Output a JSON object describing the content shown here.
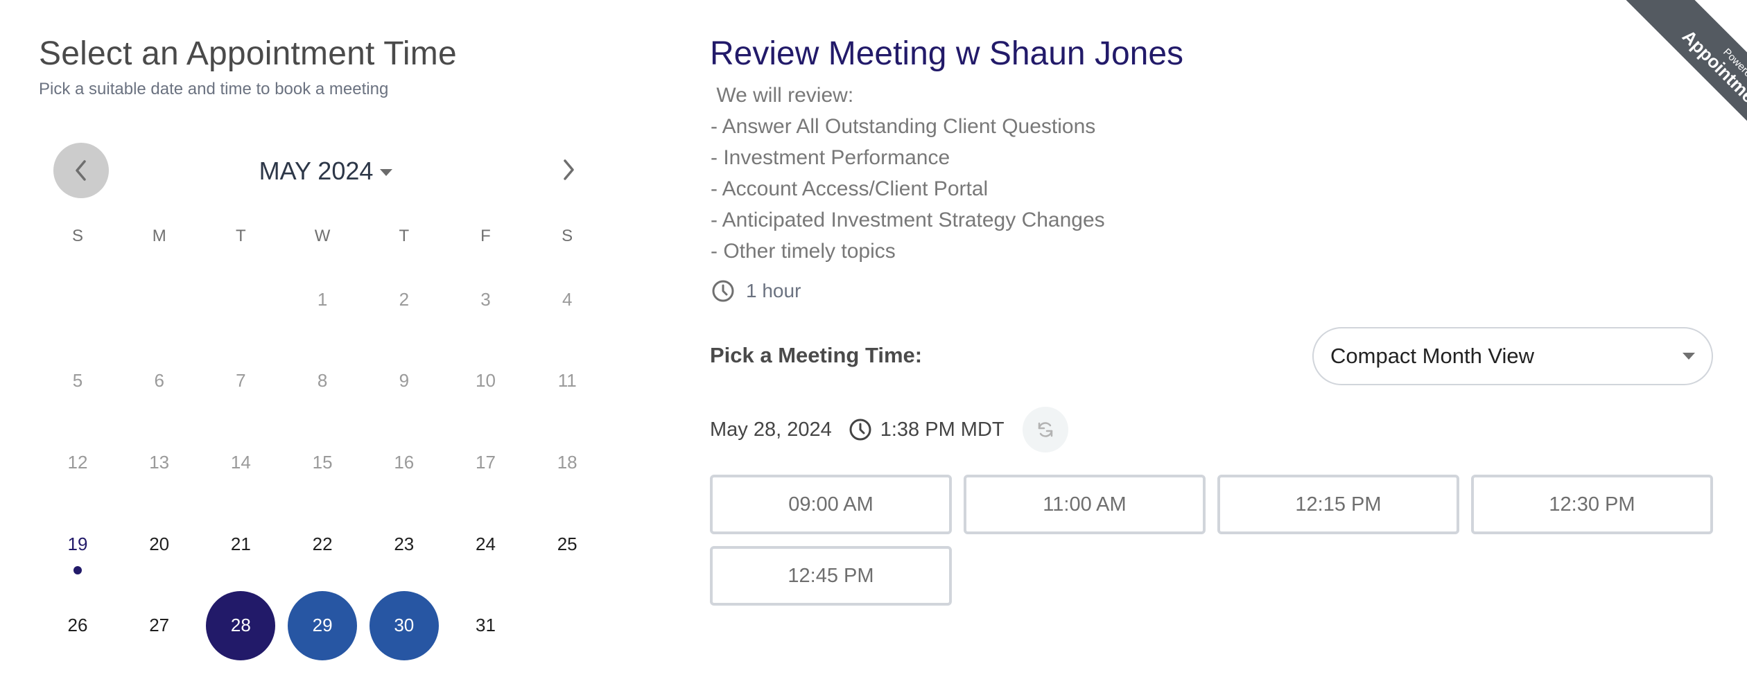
{
  "header": {
    "title": "Select an Appointment Time",
    "subtitle": "Pick a suitable date and time to book a meeting"
  },
  "calendar": {
    "month_label": "MAY 2024",
    "prev_icon": "chevron-left-icon",
    "next_icon": "chevron-right-icon",
    "weekdays": [
      "S",
      "M",
      "T",
      "W",
      "T",
      "F",
      "S"
    ],
    "first_weekday_index": 3,
    "days": [
      {
        "d": "1",
        "state": "past"
      },
      {
        "d": "2",
        "state": "past"
      },
      {
        "d": "3",
        "state": "past"
      },
      {
        "d": "4",
        "state": "past"
      },
      {
        "d": "5",
        "state": "past"
      },
      {
        "d": "6",
        "state": "past"
      },
      {
        "d": "7",
        "state": "past"
      },
      {
        "d": "8",
        "state": "past"
      },
      {
        "d": "9",
        "state": "past"
      },
      {
        "d": "10",
        "state": "past"
      },
      {
        "d": "11",
        "state": "past"
      },
      {
        "d": "12",
        "state": "past"
      },
      {
        "d": "13",
        "state": "past"
      },
      {
        "d": "14",
        "state": "past"
      },
      {
        "d": "15",
        "state": "past"
      },
      {
        "d": "16",
        "state": "past"
      },
      {
        "d": "17",
        "state": "past"
      },
      {
        "d": "18",
        "state": "past"
      },
      {
        "d": "19",
        "state": "today"
      },
      {
        "d": "20",
        "state": "avail"
      },
      {
        "d": "21",
        "state": "avail"
      },
      {
        "d": "22",
        "state": "avail"
      },
      {
        "d": "23",
        "state": "avail"
      },
      {
        "d": "24",
        "state": "avail"
      },
      {
        "d": "25",
        "state": "avail"
      },
      {
        "d": "26",
        "state": "avail"
      },
      {
        "d": "27",
        "state": "avail"
      },
      {
        "d": "28",
        "state": "selected"
      },
      {
        "d": "29",
        "state": "highlight"
      },
      {
        "d": "30",
        "state": "highlight"
      },
      {
        "d": "31",
        "state": "avail"
      }
    ],
    "colors": {
      "selected": "#221A69",
      "highlight": "#2756A3",
      "today": "#221A69",
      "past": "#9A9A9A"
    }
  },
  "meeting": {
    "title": "Review Meeting w Shaun Jones",
    "description": [
      " We will review:",
      "- Answer All Outstanding Client Questions",
      "- Investment Performance",
      "- Account Access/Client Portal",
      "- Anticipated Investment Strategy Changes",
      "- Other timely topics"
    ],
    "duration_icon": "clock-icon",
    "duration": "1 hour",
    "title_color": "#221A69"
  },
  "picker": {
    "label": "Pick a Meeting Time:",
    "view_select": {
      "selected": "Compact Month View"
    },
    "selected_date": "May 28, 2024",
    "current_time": "1:38 PM MDT",
    "refresh_icon": "refresh-icon",
    "slots": [
      "09:00 AM",
      "11:00 AM",
      "12:15 PM",
      "12:30 PM",
      "12:45 PM"
    ]
  },
  "ribbon": {
    "line1": "Powered by",
    "line2": "Appointments"
  }
}
